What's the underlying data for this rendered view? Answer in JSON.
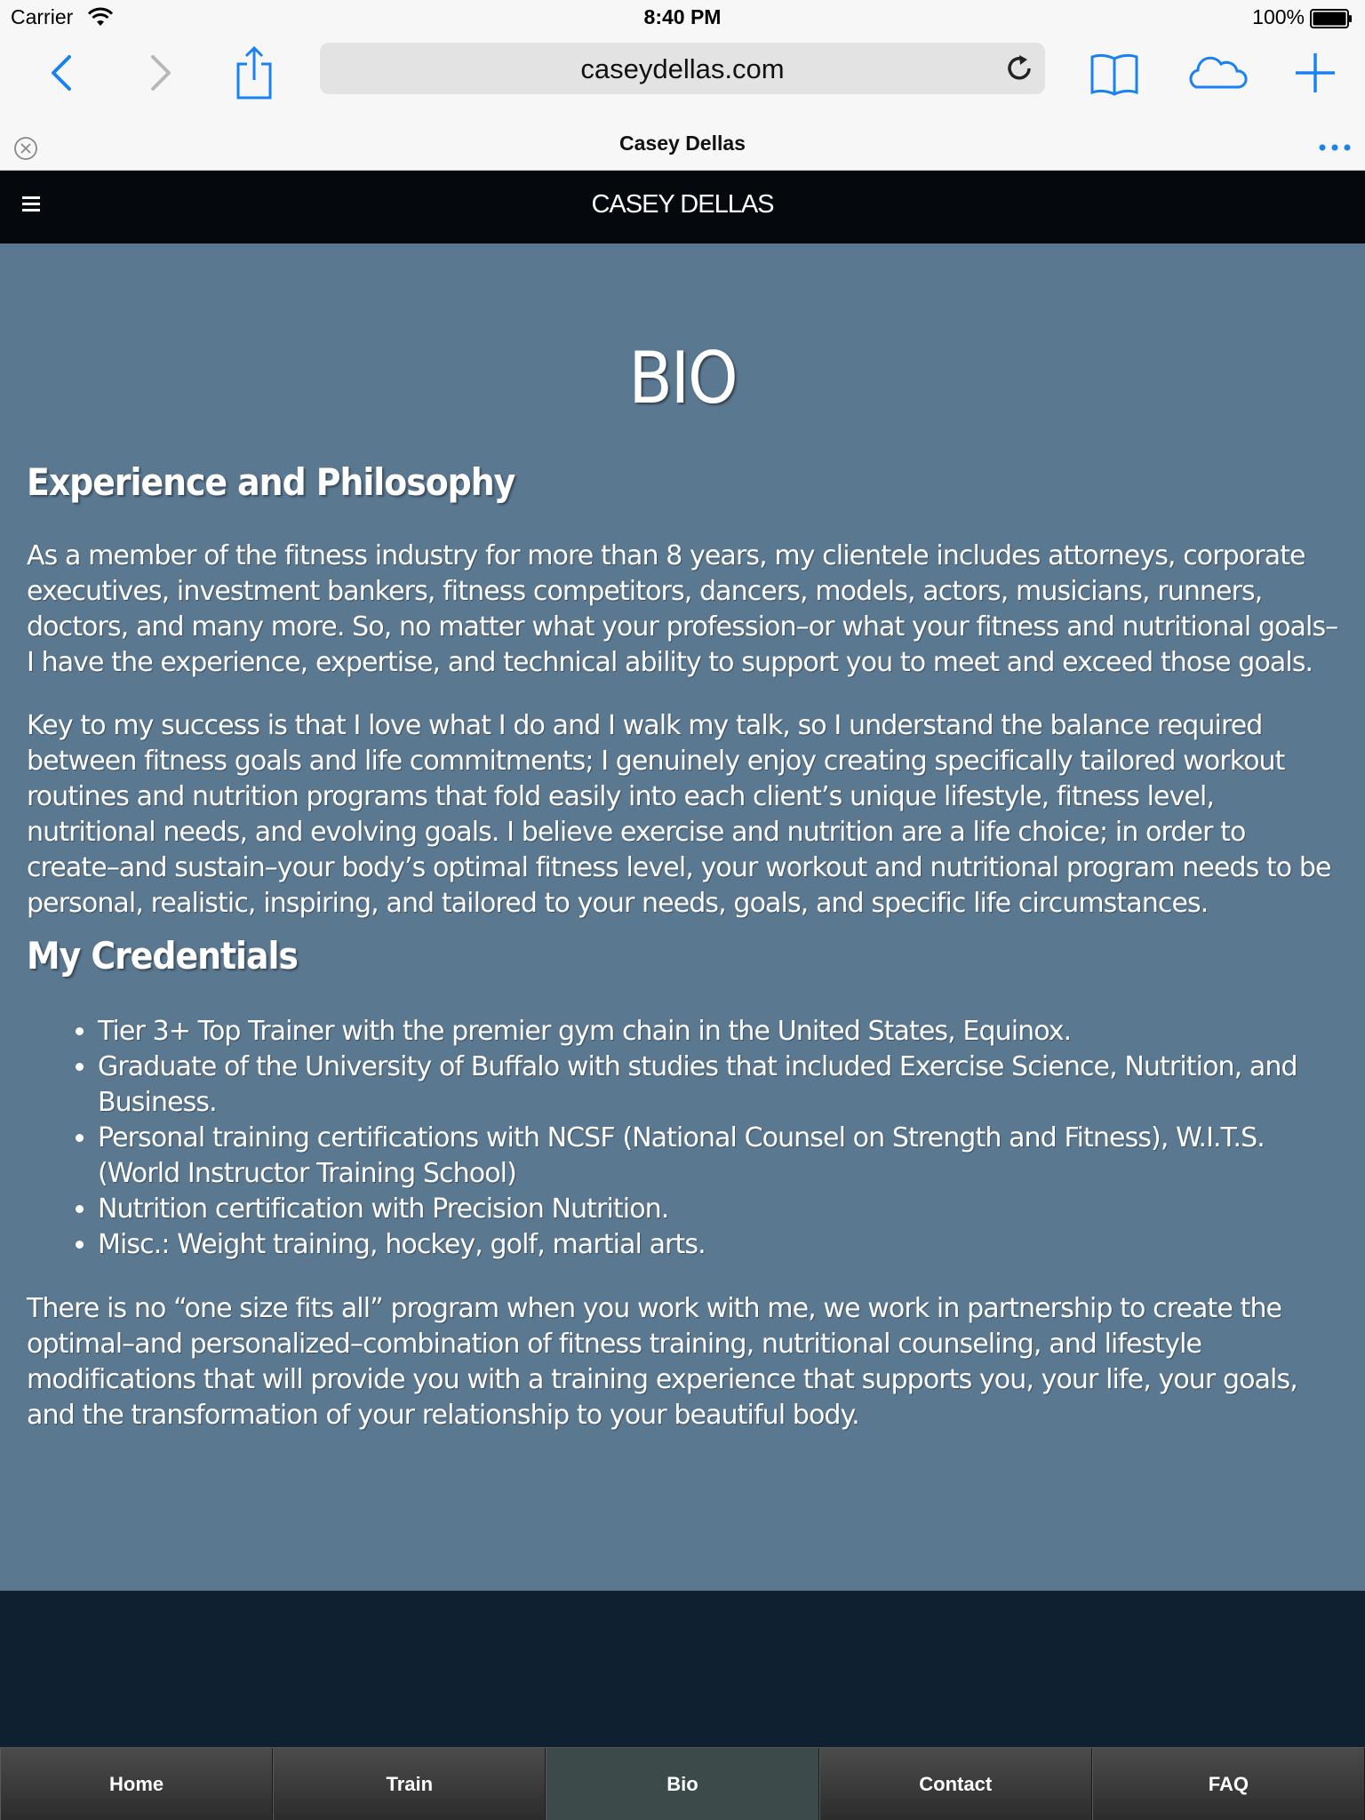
{
  "status_bar": {
    "carrier": "Carrier",
    "time": "8:40 PM",
    "battery": "100%"
  },
  "browser": {
    "url": "caseydellas.com",
    "tab_title": "Casey Dellas",
    "icons": [
      "back-icon",
      "forward-icon",
      "share-icon",
      "reload-icon",
      "bookmarks-icon",
      "cloud-tabs-icon",
      "new-tab-icon",
      "close-tab-icon",
      "more-icon"
    ],
    "accent_color": "#1a82f0"
  },
  "site": {
    "title": "CASEY DELLAS",
    "header_bg": "#05090d",
    "content_bg": "#5b7891",
    "footer_bg": "#0f2031"
  },
  "page": {
    "heading": "BIO",
    "experience": {
      "heading": "Experience and Philosophy",
      "p1": "As a member of the fitness industry for more than 8 years, my clientele includes attorneys, corporate executives, investment bankers, fitness competitors, dancers, models, actors, musicians, runners, doctors, and many more. So, no matter what your profession–or what your fitness and nutritional goals–I have the experience, expertise, and technical ability to support you to meet and exceed those goals.",
      "p2": "Key to my success is that I love what I do and I walk my talk, so I understand the balance required between fitness goals and life commitments; I genuinely enjoy creating specifically tailored workout routines and nutrition programs that fold easily into each client’s unique lifestyle, fitness level, nutritional needs, and evolving goals. I believe exercise and nutrition are a life choice; in order to create–and sustain–your body’s optimal fitness level, your workout and nutritional program needs to be personal, realistic, inspiring, and tailored to your needs, goals, and specific life circumstances."
    },
    "credentials": {
      "heading": "My Credentials",
      "items": [
        "Tier 3+ Top Trainer with the premier gym chain in the United States, Equinox.",
        "Graduate of the University of Buffalo with studies that included Exercise Science, Nutrition, and Business.",
        "Personal training certifications with NCSF (National Counsel on Strength and Fitness), W.I.T.S. (World Instructor Training School)",
        "Nutrition certification with Precision Nutrition.",
        "Misc.: Weight training, hockey, golf, martial arts."
      ],
      "closing": "There is no “one size fits all” program when you work with me, we work in partnership to create the optimal–and personalized–combination of fitness training, nutritional counseling, and lifestyle modifications that will provide you with a training experience that supports you, your life, your goals, and the transformation of your relationship to your beautiful body."
    }
  },
  "bottom_nav": {
    "items": [
      "Home",
      "Train",
      "Bio",
      "Contact",
      "FAQ"
    ],
    "active": "Bio"
  }
}
